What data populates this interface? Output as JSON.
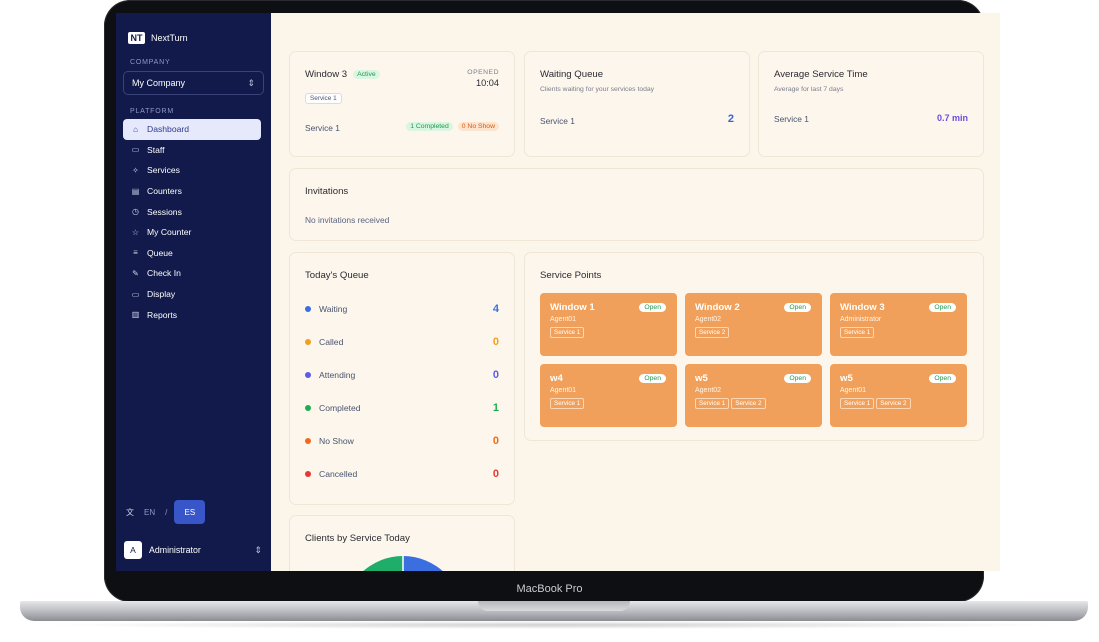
{
  "device_label": "MacBook Pro",
  "sidebar": {
    "brand_logo": "NT",
    "brand_name": "NextTurn",
    "company_label": "COMPANY",
    "company_value": "My Company",
    "platform_label": "PLATFORM",
    "items": [
      {
        "label": "Dashboard",
        "icon": "home-icon"
      },
      {
        "label": "Staff",
        "icon": "id-card-icon"
      },
      {
        "label": "Services",
        "icon": "services-icon"
      },
      {
        "label": "Counters",
        "icon": "counter-icon"
      },
      {
        "label": "Sessions",
        "icon": "clock-icon"
      },
      {
        "label": "My Counter",
        "icon": "star-icon"
      },
      {
        "label": "Queue",
        "icon": "list-icon"
      },
      {
        "label": "Check In",
        "icon": "edit-icon"
      },
      {
        "label": "Display",
        "icon": "monitor-icon"
      },
      {
        "label": "Reports",
        "icon": "bar-chart-icon"
      }
    ],
    "active_item": "Dashboard",
    "lang_en": "EN",
    "lang_sep": "/",
    "lang_es": "ES",
    "user_initial": "A",
    "user_name": "Administrator"
  },
  "window_card": {
    "title": "Window 3",
    "status": "Active",
    "service_tag": "Service 1",
    "opened_label": "OPENED",
    "opened_time": "10:04",
    "service": "Service 1",
    "completed_badge": "1 Completed",
    "no_show_badge": "0 No Show"
  },
  "waiting_queue": {
    "title": "Waiting Queue",
    "subtitle": "Clients waiting for your services today",
    "service": "Service 1",
    "value": "2"
  },
  "avg_service": {
    "title": "Average Service Time",
    "subtitle": "Average for last 7 days",
    "service": "Service 1",
    "value": "0.7 min"
  },
  "invitations": {
    "title": "Invitations",
    "empty_text": "No invitations received"
  },
  "todays_queue": {
    "title": "Today's Queue",
    "rows": [
      {
        "label": "Waiting",
        "value": "4",
        "color": "#3b6fe0"
      },
      {
        "label": "Called",
        "value": "0",
        "color": "#f0a020"
      },
      {
        "label": "Attending",
        "value": "0",
        "color": "#5b5de8"
      },
      {
        "label": "Completed",
        "value": "1",
        "color": "#1fae4f"
      },
      {
        "label": "No Show",
        "value": "0",
        "color": "#f06a1a"
      },
      {
        "label": "Cancelled",
        "value": "0",
        "color": "#e53935"
      }
    ]
  },
  "service_points": {
    "title": "Service Points",
    "items": [
      {
        "name": "Window 1",
        "agent": "Agent01",
        "status": "Open",
        "services": [
          "Service 1"
        ]
      },
      {
        "name": "Window 2",
        "agent": "Agent02",
        "status": "Open",
        "services": [
          "Service 2"
        ]
      },
      {
        "name": "Window 3",
        "agent": "Administrator",
        "status": "Open",
        "services": [
          "Service 1"
        ]
      },
      {
        "name": "w4",
        "agent": "Agent01",
        "status": "Open",
        "services": [
          "Service 1"
        ]
      },
      {
        "name": "w5",
        "agent": "Agent02",
        "status": "Open",
        "services": [
          "Service 1",
          "Service 2"
        ]
      },
      {
        "name": "w5",
        "agent": "Agent01",
        "status": "Open",
        "services": [
          "Service 1",
          "Service 2"
        ]
      }
    ]
  },
  "clients_by_service": {
    "title": "Clients by Service Today",
    "colors": [
      "#1fae6a",
      "#3b6fe0"
    ]
  },
  "colors": {
    "sidebar_bg": "#111a4a",
    "main_bg": "#fcf5e9",
    "accent_blue": "#3956c9",
    "service_point_bg": "#f0a05a"
  }
}
